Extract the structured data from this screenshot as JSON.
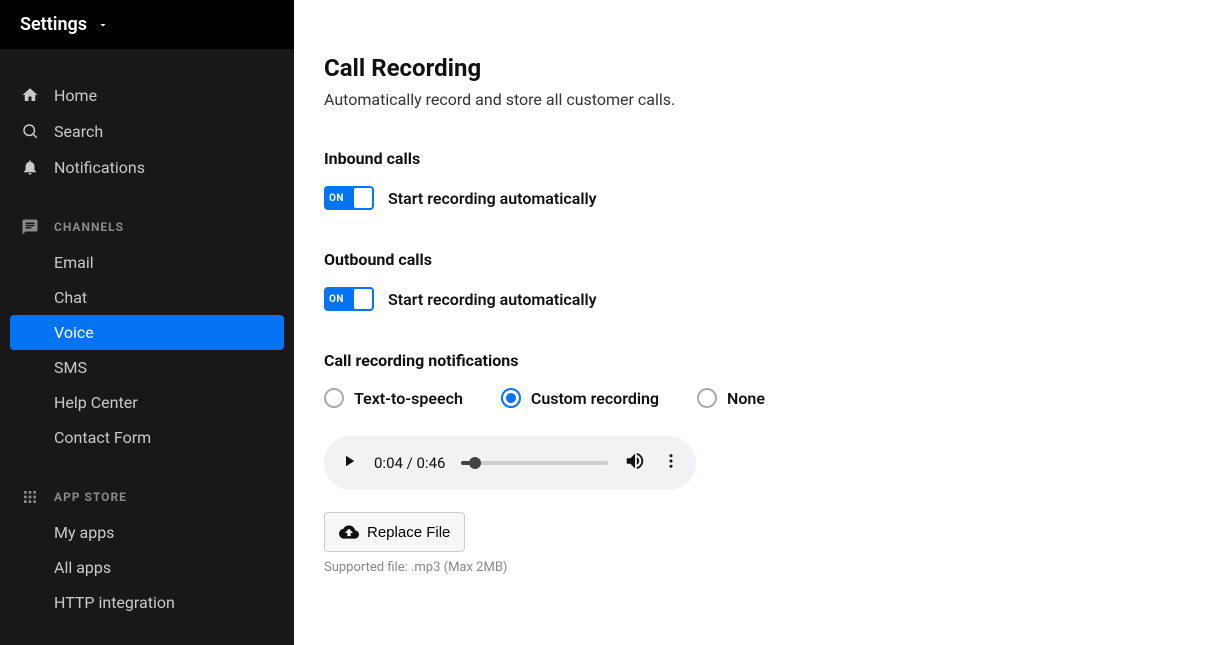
{
  "sidebar": {
    "title": "Settings",
    "nav": [
      {
        "label": "Home",
        "icon": "home-icon"
      },
      {
        "label": "Search",
        "icon": "search-icon"
      },
      {
        "label": "Notifications",
        "icon": "bell-icon"
      }
    ],
    "sections": [
      {
        "header": "CHANNELS",
        "icon": "chat-icon",
        "items": [
          {
            "label": "Email",
            "active": false
          },
          {
            "label": "Chat",
            "active": false
          },
          {
            "label": "Voice",
            "active": true
          },
          {
            "label": "SMS",
            "active": false
          },
          {
            "label": "Help Center",
            "active": false
          },
          {
            "label": "Contact Form",
            "active": false
          }
        ]
      },
      {
        "header": "APP STORE",
        "icon": "grid-icon",
        "items": [
          {
            "label": "My apps",
            "active": false
          },
          {
            "label": "All apps",
            "active": false
          },
          {
            "label": "HTTP integration",
            "active": false
          }
        ]
      }
    ]
  },
  "page": {
    "title": "Call Recording",
    "subtitle": "Automatically record and store all customer calls."
  },
  "inbound": {
    "label": "Inbound calls",
    "toggle_on": "ON",
    "toggle_text": "Start recording automatically"
  },
  "outbound": {
    "label": "Outbound calls",
    "toggle_on": "ON",
    "toggle_text": "Start recording automatically"
  },
  "notifications": {
    "label": "Call recording notifications",
    "options": {
      "tts": "Text-to-speech",
      "custom": "Custom recording",
      "none": "None"
    },
    "selected": "custom"
  },
  "audio": {
    "time": "0:04 / 0:46"
  },
  "replace": {
    "button": "Replace File",
    "supported": "Supported file: .mp3 (Max 2MB)"
  }
}
